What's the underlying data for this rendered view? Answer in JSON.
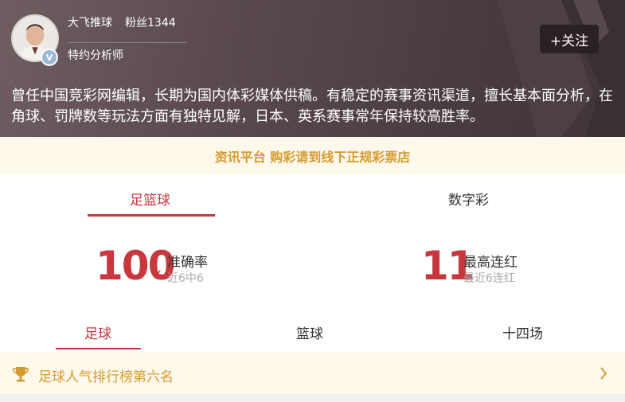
{
  "expert": {
    "name": "大飞推球",
    "fans": "粉丝1344",
    "title": "特约分析师",
    "follow_label": "+关注",
    "bio": "曾任中国竞彩网编辑，长期为国内体彩媒体供稿。有稳定的赛事资讯渠道，擅长基本面分析，在角球、罚牌数等玩法方面有独特见解，日本、英系赛事常年保持较高胜率。",
    "verified_badge": "V"
  },
  "notice": "资讯平台 购彩请到线下正规彩票店",
  "main_tabs": [
    {
      "label": "足篮球",
      "active": true
    },
    {
      "label": "数字彩",
      "active": false
    }
  ],
  "stats": {
    "accuracy": {
      "value": "100",
      "unit": "%",
      "label": "准确率",
      "sub": "近6中6"
    },
    "streak": {
      "value": "11",
      "label": "最高连红",
      "sub": "最近6连红"
    }
  },
  "sub_tabs": [
    {
      "label": "足球",
      "active": true
    },
    {
      "label": "篮球",
      "active": false
    },
    {
      "label": "十四场",
      "active": false
    }
  ],
  "ranking": {
    "text": "足球人气排行榜第六名"
  },
  "colors": {
    "accent": "#c8373e",
    "gold": "#d49a2f",
    "header_bg": "#5a4a50",
    "notice_bg": "#fff9ec"
  },
  "icons": [
    "verified-icon",
    "trophy-icon",
    "chevron-right-icon"
  ]
}
